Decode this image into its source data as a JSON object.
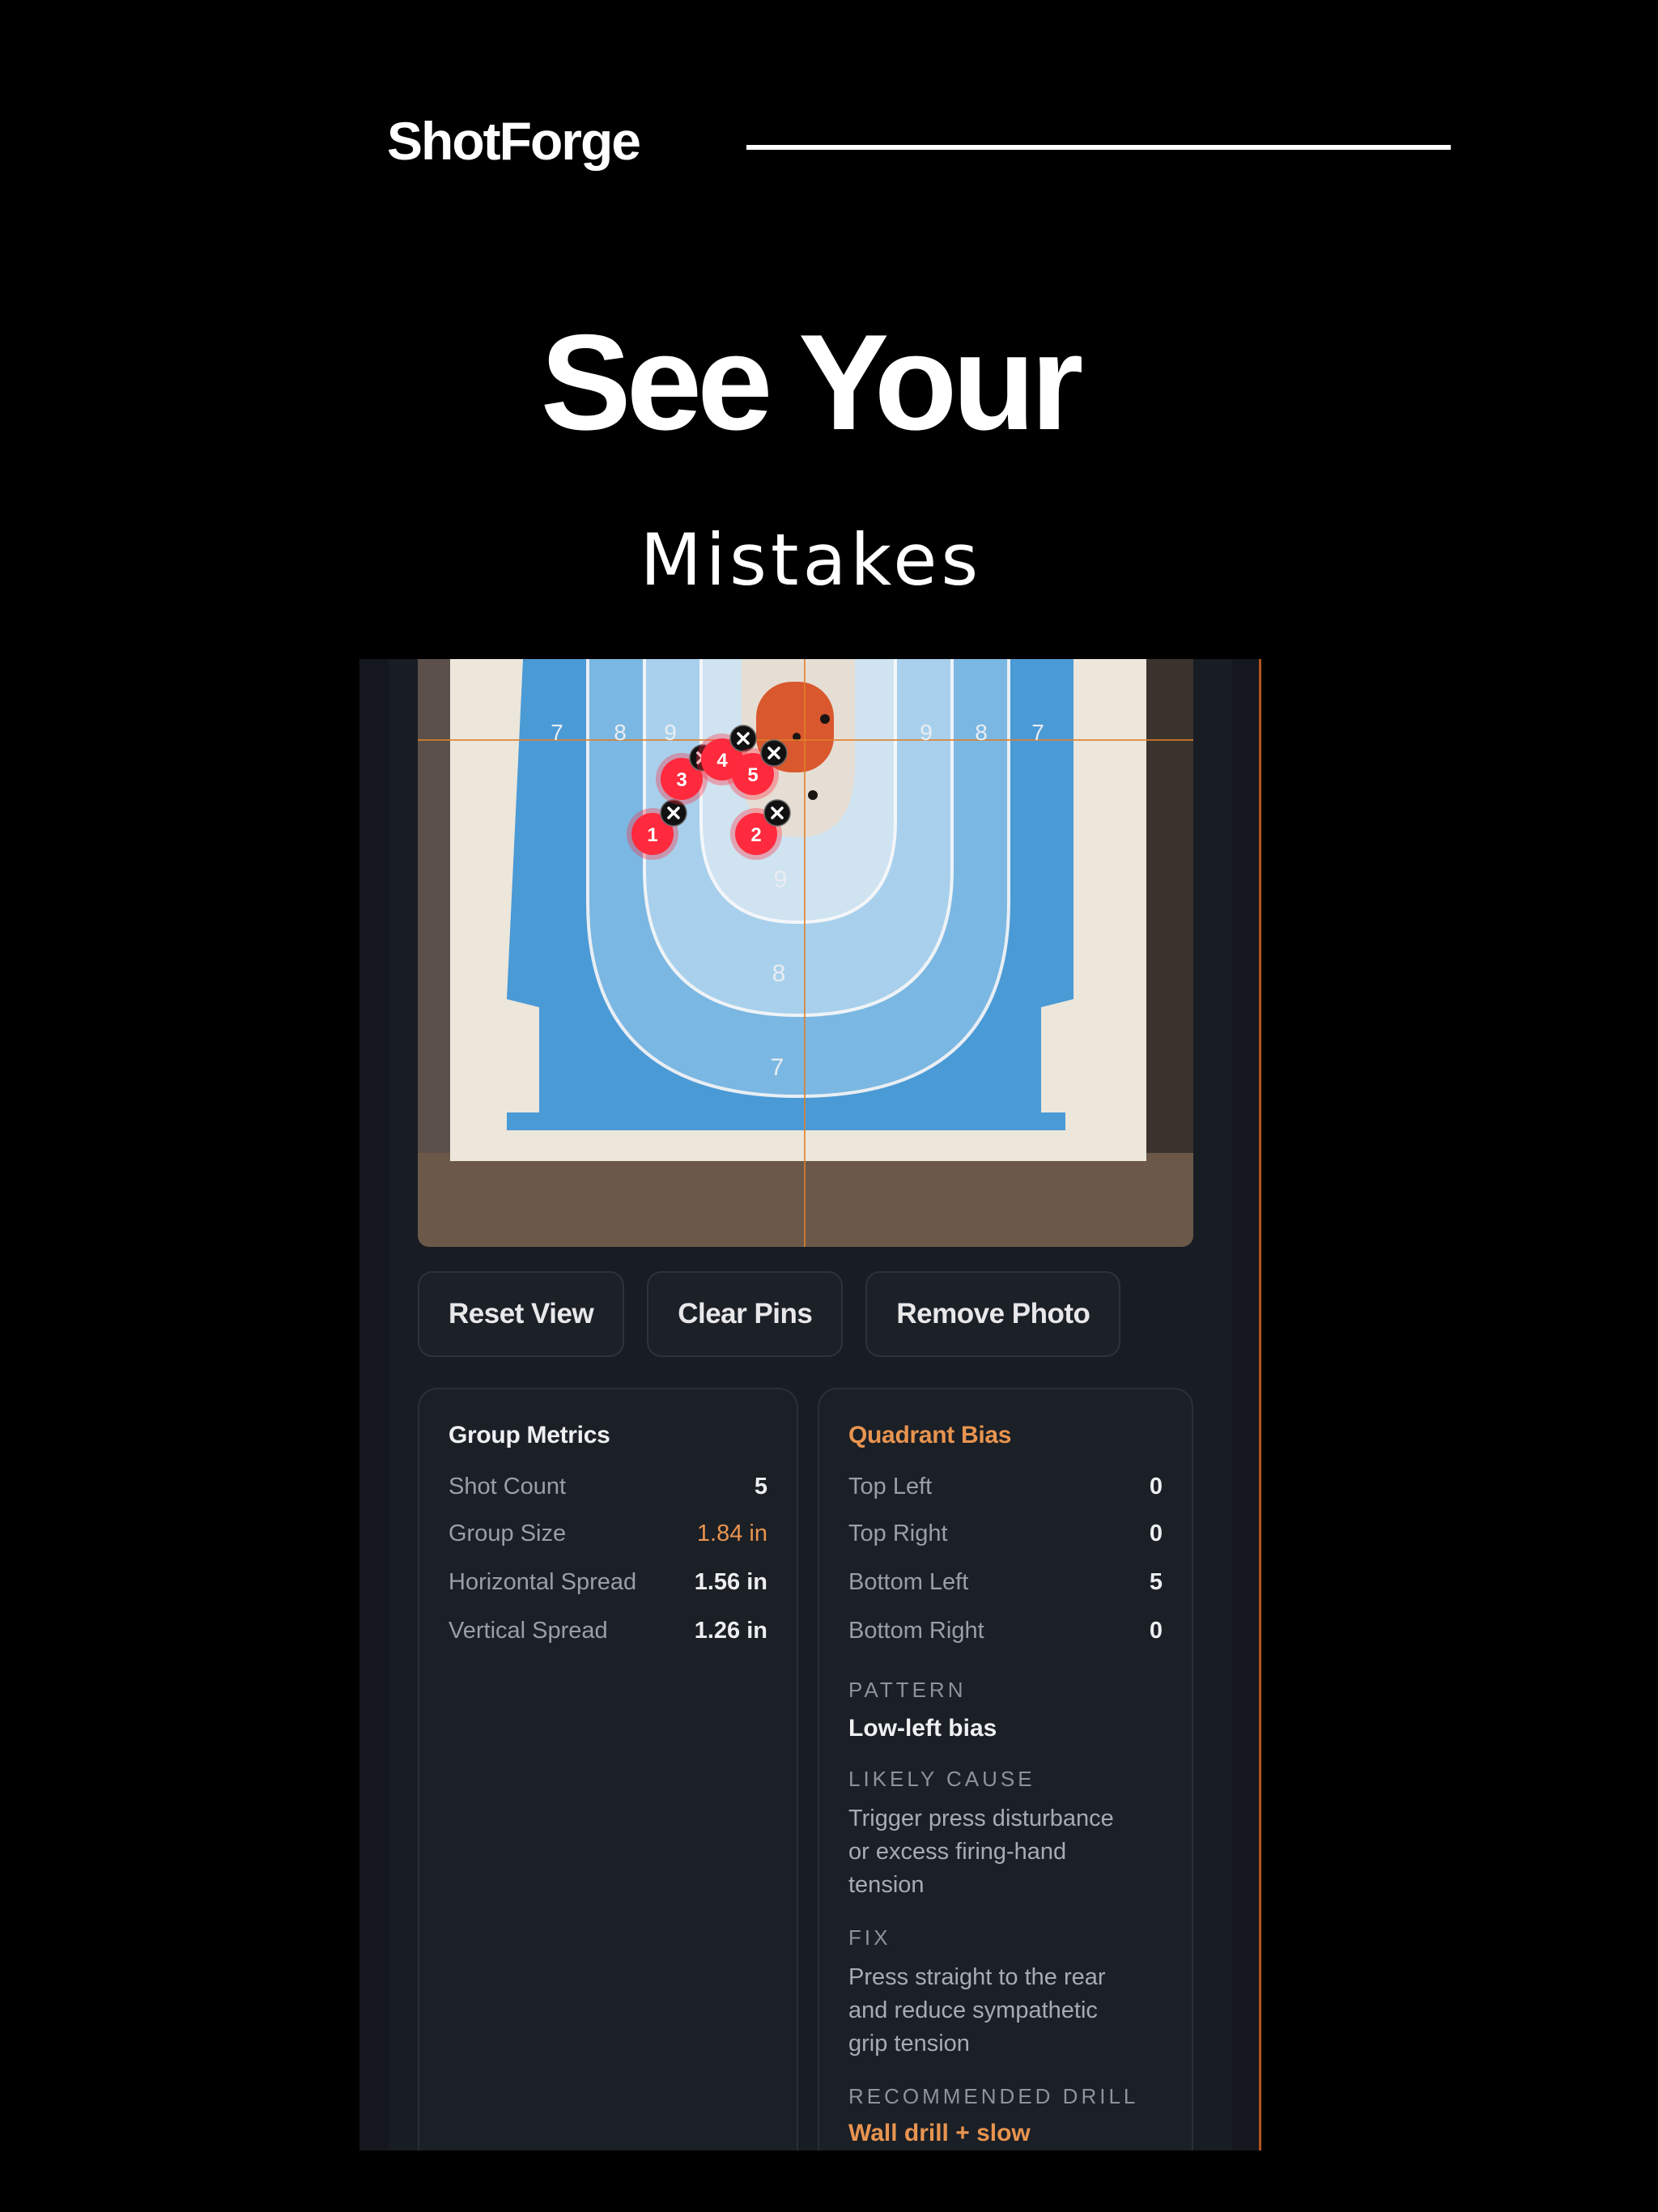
{
  "brand": {
    "name": "ShotForge"
  },
  "hero": {
    "title": "See Your",
    "subtitle": "Mistakes"
  },
  "target": {
    "ring_labels_top": [
      "7",
      "8",
      "9",
      "9",
      "8",
      "7"
    ],
    "ring_labels_center": [
      "9",
      "8",
      "7"
    ],
    "shots": [
      {
        "label": "1"
      },
      {
        "label": "2"
      },
      {
        "label": "3"
      },
      {
        "label": "4"
      },
      {
        "label": "5"
      }
    ],
    "colors": {
      "pin": "#ff2a3d",
      "crosshair": "#e0802a",
      "target_blue": "#4a9ad6"
    }
  },
  "controls": {
    "reset_view": "Reset View",
    "clear_pins": "Clear Pins",
    "remove_photo": "Remove Photo"
  },
  "metrics": {
    "title": "Group Metrics",
    "rows": [
      {
        "label": "Shot Count",
        "value": "5"
      },
      {
        "label": "Group Size",
        "value": "1.84 in"
      },
      {
        "label": "Horizontal Spread",
        "value": "1.56 in"
      },
      {
        "label": "Vertical Spread",
        "value": "1.26 in"
      }
    ]
  },
  "bias": {
    "title": "Quadrant Bias",
    "rows": [
      {
        "label": "Top Left",
        "value": "0"
      },
      {
        "label": "Top Right",
        "value": "0"
      },
      {
        "label": "Bottom Left",
        "value": "5"
      },
      {
        "label": "Bottom Right",
        "value": "0"
      }
    ],
    "pattern_label": "PATTERN",
    "pattern_value": "Low-left bias",
    "cause_label": "LIKELY CAUSE",
    "cause_lines": [
      "Trigger press disturbance",
      "or excess firing-hand",
      "tension"
    ],
    "fix_label": "FIX",
    "fix_lines": [
      "Press straight to the rear",
      "and reduce sympathetic",
      "grip tension"
    ],
    "drill_label": "RECOMMENDED DRILL",
    "drill_value": "Wall drill + slow"
  }
}
